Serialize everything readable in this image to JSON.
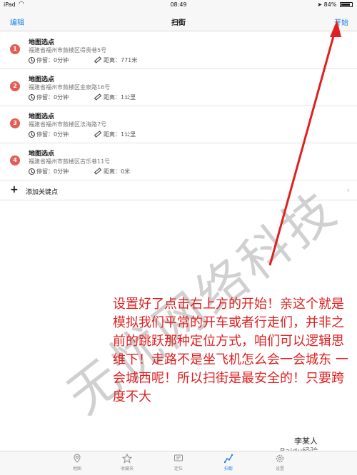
{
  "status_bar": {
    "device": "iPad",
    "time": "08:49",
    "battery": "84%"
  },
  "nav": {
    "left": "编辑",
    "title": "扫街",
    "right": "开始"
  },
  "points": [
    {
      "index": "1",
      "title": "地图选点",
      "address": "福建省福州市鼓楼区得贵巷5号",
      "stay": "停留：0分钟",
      "distance": "距离：771米"
    },
    {
      "index": "2",
      "title": "地图选点",
      "address": "福建省福州市鼓楼区金泉路16号",
      "stay": "停留：0分钟",
      "distance": "距离：1公里"
    },
    {
      "index": "3",
      "title": "地图选点",
      "address": "福建省福州市鼓楼区法海路7号",
      "stay": "停留：0分钟",
      "distance": "距离：1公里"
    },
    {
      "index": "4",
      "title": "地图选点",
      "address": "福建省福州市鼓楼区古乐巷11号",
      "stay": "停留：0分钟",
      "distance": "距离：0米"
    }
  ],
  "add_key_point": "添加关键点",
  "watermark": "无忧网络科技",
  "annotation": "设置好了点击右上方的开始！亲这个就是模拟我们平常的开车或者行走们，并非之前的跳跃那种定位方式，咱们可以逻辑思维下！走路不是坐飞机怎么会一会城东 一会城西呢！所以扫街是最安全的！只要跨度不大",
  "signature": "李某人",
  "site_mark": "Baidu经验",
  "tabs": [
    {
      "label": "地图",
      "icon": "map-pin-icon"
    },
    {
      "label": "收藏夹",
      "icon": "star-icon"
    },
    {
      "label": "定位",
      "icon": "message-icon"
    },
    {
      "label": "扫街",
      "icon": "route-icon"
    },
    {
      "label": "设置",
      "icon": "gear-icon"
    }
  ],
  "colors": {
    "accent": "#1a7fe6",
    "badge": "#e35d55",
    "annotation": "#e02020"
  }
}
